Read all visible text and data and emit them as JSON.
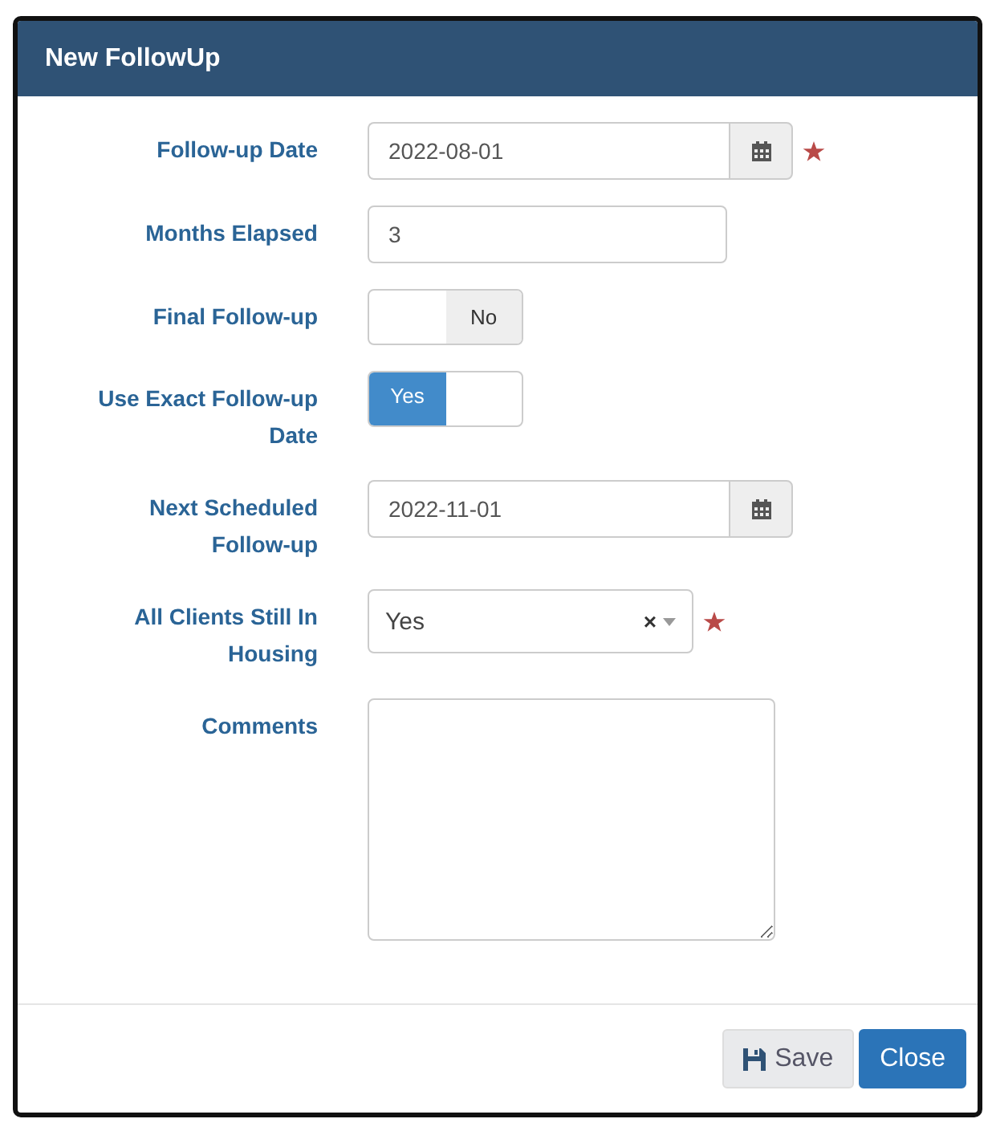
{
  "dialog": {
    "title": "New FollowUp"
  },
  "fields": [
    {
      "kind": "date",
      "label": "Follow-up Date",
      "value": "2022-08-01",
      "required": true
    },
    {
      "kind": "text",
      "label": "Months Elapsed",
      "value": "3",
      "required": false
    },
    {
      "kind": "toggle",
      "label": "Final Follow-up",
      "state_label": "No",
      "on": false,
      "required": false
    },
    {
      "kind": "toggle",
      "label": "Use Exact Follow-up Date",
      "state_label": "Yes",
      "on": true,
      "required": false
    },
    {
      "kind": "date",
      "label": "Next Scheduled Follow-up",
      "value": "2022-11-01",
      "required": false
    },
    {
      "kind": "select",
      "label": "All Clients Still In Housing",
      "value": "Yes",
      "clear": "×",
      "required": true
    },
    {
      "kind": "textarea",
      "label": "Comments",
      "required": false
    }
  ],
  "buttons": [
    {
      "kind": "save",
      "label": "Save"
    },
    {
      "kind": "close",
      "label": "Close"
    }
  ]
}
